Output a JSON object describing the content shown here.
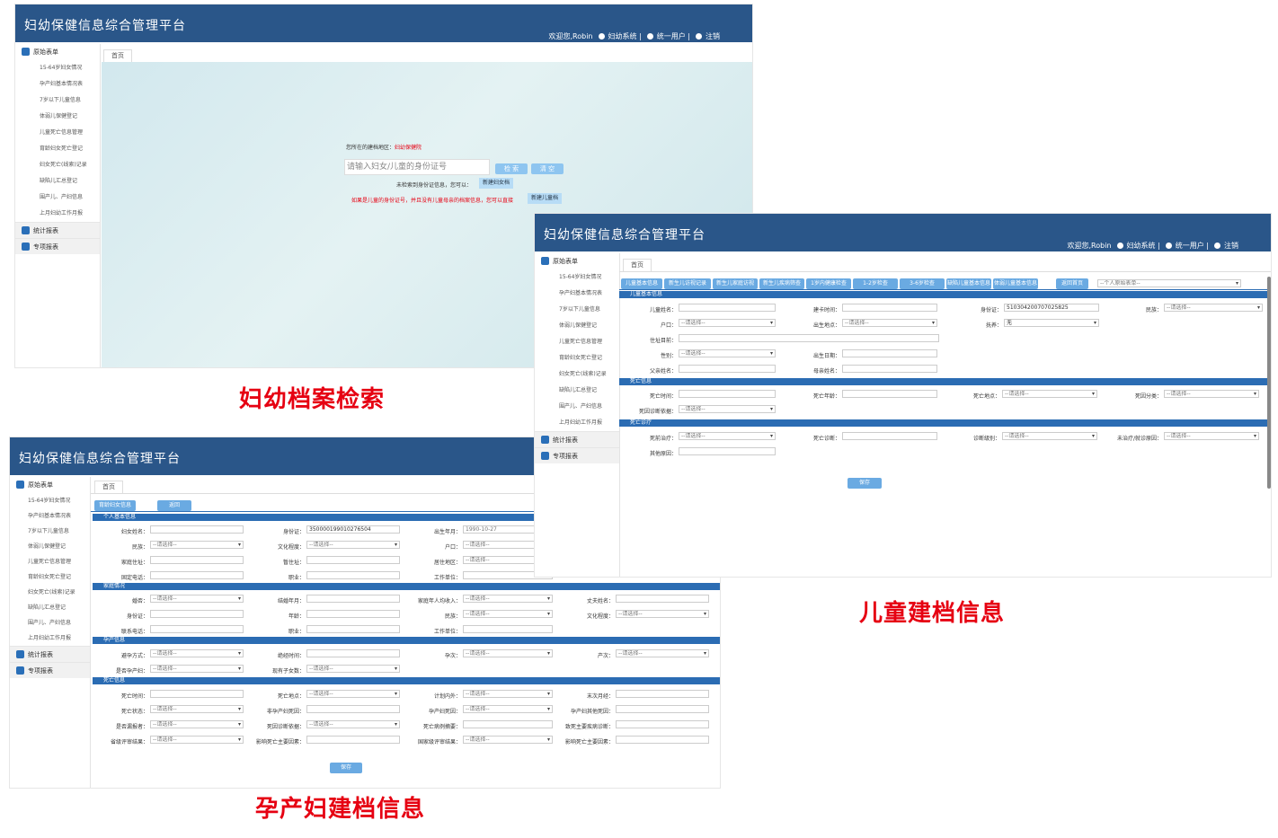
{
  "app_title": "妇幼保健信息综合管理平台",
  "user_bar": {
    "welcome": "欢迎您,Robin",
    "sys": "妇幼系统",
    "unified": "统一用户",
    "logout": "注销"
  },
  "sidebar": {
    "head": "原始表单",
    "items": [
      "15-64岁妇女情况",
      "孕产妇基本情况表",
      "7岁以下儿童信息",
      "体弱儿保健登记",
      "儿童死亡信息管理",
      "育龄妇女死亡登记",
      "妇女死亡(线索)记录",
      "缺陷儿汇总登记",
      "围产儿、产妇信息",
      "上月妇幼工作月报"
    ],
    "stat": "统计报表",
    "special": "专项报表"
  },
  "home_tab": "首页",
  "search": {
    "region_label": "您所在的建档地区：",
    "region": "妇幼保健院",
    "placeholder": "请输入妇女/儿童的身份证号",
    "search_btn": "检 索",
    "clear_btn": "清 空",
    "not_found": "未检索到身份证信息，您可以：",
    "new_woman": "新建妇女档",
    "hint": "如果是儿童的身份证号，并且没有儿童母亲的档案信息，您可以直接",
    "new_child": "新建儿童档"
  },
  "captions": {
    "search": "妇幼档案检索",
    "child": "儿童建档信息",
    "mother": "孕产妇建档信息"
  },
  "child": {
    "tabs": [
      "儿童基本信息",
      "新生儿访视记录",
      "新生儿家庭访视",
      "新生儿疾病筛查",
      "1岁内健康检查",
      "1-2岁检查",
      "3-6岁检查",
      "缺陷儿童基本信息",
      "体弱儿童基本信息"
    ],
    "back": "返回首页",
    "select": "--个人原始表单--",
    "sec_basic": "儿童基本信息",
    "sec_death": "死亡信息",
    "sec_treat": "死亡诊疗",
    "labels": {
      "name": "儿童姓名：",
      "build_time": "建卡时间：",
      "id": "身份证：",
      "ethnic": "民族：",
      "hukou": "户口：",
      "birthplace": "出生地点：",
      "raise": "抚养：",
      "address": "住址目前：",
      "sex": "性别：",
      "birth_date": "出生日期：",
      "father": "父亲姓名：",
      "mother": "母亲姓名：",
      "death_time": "死亡时间：",
      "death_age": "死亡年龄：",
      "death_place": "死亡地点：",
      "death_class": "死因分类：",
      "death_basis": "死因诊断依据：",
      "pre_treat": "死前治疗：",
      "pre_diag": "死亡诊断：",
      "diag_level": "诊断级别：",
      "untreated": "未治疗/就诊原因：",
      "other": "其他原因："
    },
    "values": {
      "id": "510304200707025825",
      "ethnic": "--请选择--",
      "hukou": "--请选择--",
      "birthplace": "--请选择--",
      "raise": "无",
      "sex": "--请选择--",
      "death_place": "--请选择--",
      "death_class": "--请选择--",
      "death_basis": "--请选择--",
      "pre_treat": "--请选择--",
      "diag_level": "--请选择--",
      "untreated": "--请选择--"
    },
    "save": "保存"
  },
  "mother": {
    "tab": "育龄妇女信息",
    "back": "返回",
    "sec_personal": "个人基本信息",
    "sec_family": "家庭情况",
    "sec_preg": "孕产信息",
    "sec_death": "死亡信息",
    "labels": {
      "name": "妇女姓名：",
      "id": "身份证：",
      "birth": "出生年月：",
      "ethnic": "民族：",
      "edu": "文化程度：",
      "hukou": "户口：",
      "home_addr": "家庭住址：",
      "temp_addr": "暂住址：",
      "live_area": "居住地区：",
      "fixed_phone": "固定电话：",
      "job": "职业：",
      "work_unit": "工作单位：",
      "marriage": "婚否：",
      "marry_date": "结婚年月：",
      "income": "家庭年人均收入：",
      "husband": "丈夫姓名：",
      "h_id": "身份证：",
      "h_age": "年龄：",
      "h_ethnic": "民族：",
      "h_edu": "文化程度：",
      "contact": "联系电话：",
      "h_job": "职业：",
      "h_unit": "工作单位：",
      "contra": "避孕方式：",
      "ligation": "绝经时间：",
      "gravida": "孕次：",
      "parity": "产次：",
      "is_preg": "是否孕产妇：",
      "children": "现有子女数：",
      "death_time": "死亡时间：",
      "death_place": "死亡地点：",
      "plan": "计划内外：",
      "lmp": "末次月经：",
      "death_state": "死亡状态：",
      "non_preg_cause": "非孕产妇死因：",
      "preg_cause": "孕产妇死因：",
      "preg_other": "孕产妇其他死因：",
      "reported": "是否漏报者：",
      "basis": "死因诊断依据：",
      "disease": "死亡病例摘要：",
      "main_disease": "致死主要疾病诊断：",
      "prov_eval": "省级评审结果：",
      "factor": "影响死亡主要因素：",
      "nat_eval": "国家级评审结果：",
      "factor2": "影响死亡主要因素："
    },
    "values": {
      "id": "350000199010276504",
      "birth": "1990-10-27",
      "sel": "--请选择--"
    },
    "save": "保存"
  }
}
